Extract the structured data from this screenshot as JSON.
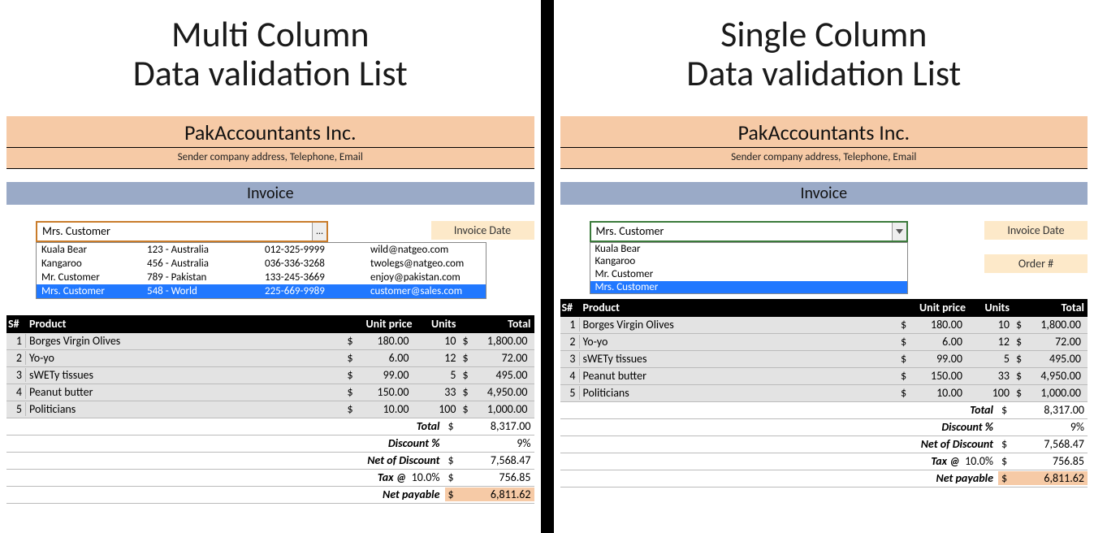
{
  "left": {
    "title_line1": "Multi Column",
    "title_line2": "Data validation List",
    "company": "PakAccountants Inc.",
    "company_sub": "Sender company address, Telephone, Email",
    "invoice_label": "Invoice",
    "combo_value": "Mrs. Customer",
    "invoice_date_label": "Invoice Date",
    "dropdown": [
      {
        "name": "Kuala Bear",
        "addr": "123 - Australia",
        "phone": "012-325-9999",
        "email": "wild@natgeo.com"
      },
      {
        "name": "Kangaroo",
        "addr": "456 - Australia",
        "phone": "036-336-3268",
        "email": "twolegs@natgeo.com"
      },
      {
        "name": "Mr. Customer",
        "addr": "789 - Pakistan",
        "phone": "133-245-3669",
        "email": "enjoy@pakistan.com"
      },
      {
        "name": "Mrs. Customer",
        "addr": "548 - World",
        "phone": "225-669-9989",
        "email": "customer@sales.com"
      }
    ]
  },
  "right": {
    "title_line1": "Single Column",
    "title_line2": "Data validation List",
    "company": "PakAccountants Inc.",
    "company_sub": "Sender company address, Telephone, Email",
    "invoice_label": "Invoice",
    "combo_value": "Mrs. Customer",
    "invoice_date_label": "Invoice Date",
    "order_label": "Order #",
    "dropdown": [
      "Kuala Bear",
      "Kangaroo",
      "Mr. Customer",
      "Mrs. Customer"
    ]
  },
  "table": {
    "h_sn": "S#",
    "h_prod": "Product",
    "h_up": "Unit price",
    "h_units": "Units",
    "h_total": "Total",
    "rows": [
      {
        "sn": "1",
        "prod": "Borges Virgin Olives",
        "up": "180.00",
        "units": "10",
        "total": "1,800.00"
      },
      {
        "sn": "2",
        "prod": "Yo-yo",
        "up": "6.00",
        "units": "12",
        "total": "72.00"
      },
      {
        "sn": "3",
        "prod": "sWETy tissues",
        "up": "99.00",
        "units": "5",
        "total": "495.00"
      },
      {
        "sn": "4",
        "prod": "Peanut butter",
        "up": "150.00",
        "units": "33",
        "total": "4,950.00"
      },
      {
        "sn": "5",
        "prod": "Politicians",
        "up": "10.00",
        "units": "100",
        "total": "1,000.00"
      }
    ],
    "sum_total_label": "Total",
    "sum_total": "8,317.00",
    "discount_label": "Discount %",
    "discount": "9%",
    "net_discount_label": "Net of Discount",
    "net_discount": "7,568.47",
    "tax_label": "Tax @",
    "tax_rate": "10.0%",
    "tax": "756.85",
    "net_payable_label": "Net payable",
    "net_payable": "6,811.62",
    "cur": "$"
  }
}
